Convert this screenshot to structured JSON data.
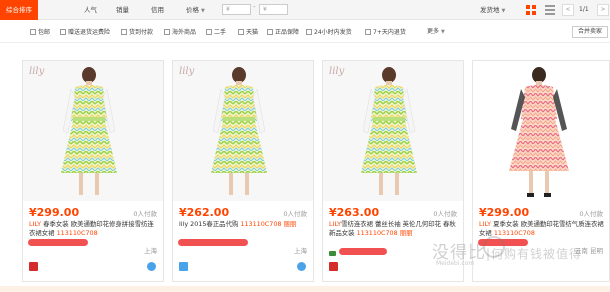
{
  "sortbar": {
    "tabs": [
      {
        "label": "综合排序",
        "active": true
      },
      {
        "label": "人气"
      },
      {
        "label": "销量"
      },
      {
        "label": "信用"
      },
      {
        "label": "价格"
      }
    ],
    "price_min_placeholder": "¥",
    "price_max_placeholder": "¥",
    "price_dash": "-",
    "ship_from": "发货地",
    "page_indicator": "1/1",
    "prev": "<",
    "next": ">"
  },
  "filters": {
    "items": [
      "包邮",
      "赠送退货运费险",
      "货到付款",
      "海外商品",
      "二手",
      "天猫",
      "正品保障",
      "24小时内发货",
      "7+天内退货"
    ],
    "more": "更多",
    "merge_btn": "合并卖家"
  },
  "products": [
    {
      "brand_logo": "lily",
      "price": "¥299.00",
      "sold": "0人付款",
      "title_prefix": "LILY",
      "title": " 春季女装 欧美通勤印花修身拼接雪纺连衣裙女裙 ",
      "code": "113110C708",
      "location": "上海",
      "dress": "zigzag"
    },
    {
      "brand_logo": "lily",
      "price": "¥262.00",
      "sold": "0人付款",
      "title_prefix": "lily",
      "title": " 2015春正品代购 ",
      "code": "113110C708",
      "extra": "丽丽",
      "location": "上海",
      "dress": "zigzag"
    },
    {
      "brand_logo": "lily",
      "price": "¥263.00",
      "sold": "0人付款",
      "title_prefix": "LILY",
      "title": "雪纺连衣裙 蕾丝长袖 英伦几何印花 春秋新品女装",
      "code": "113110C708",
      "extra": "丽丽",
      "location": "",
      "dress": "zigzag"
    },
    {
      "brand_logo": "",
      "price": "¥299.00",
      "sold": "0人付款",
      "title_prefix": "LILY",
      "title": " 夏季女装 欧美通勤印花雪纺气质连衣裙女裙 ",
      "code": "113110C708",
      "location": "云南 昆明",
      "dress": "pink"
    }
  ],
  "watermark": {
    "main": "没得比",
    "side": "|何购有钱被值得",
    "sub": "Meidebi.com"
  },
  "colors": {
    "accent": "#ff4400",
    "zig1": "#c6e86a",
    "zig2": "#f2e37a",
    "zig3": "#8fd3e0",
    "pink": "#f4a6a6"
  }
}
